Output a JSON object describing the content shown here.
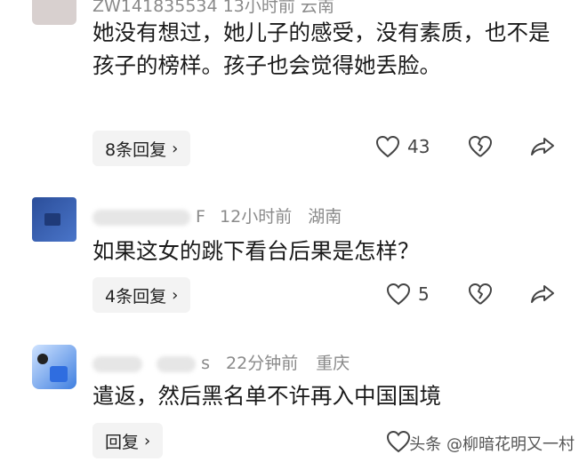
{
  "comments": [
    {
      "username": "ZW141835534 13小时前 云南",
      "text": "她没有想过，她儿子的感受，没有素质，也不是孩子的榜样。孩子也会觉得她丢脸。",
      "reply_label": "8条回复",
      "like_count": "43"
    },
    {
      "username": "F",
      "time": "12小时前",
      "location": "湖南",
      "text": "如果这女的跳下看台后果是怎样？",
      "reply_label": "4条回复",
      "like_count": "5"
    },
    {
      "username": "s",
      "time": "22分钟前",
      "location": "重庆",
      "text": "遣返，然后黑名单不许再入中国国境",
      "reply_label": "回复"
    }
  ],
  "watermark": "头条 @柳暗花明又一村",
  "colors": {
    "meta": "#8a8a8a",
    "reply_bg": "#f3f3f3",
    "text": "#1a1a1a"
  },
  "icons": [
    "like-heart-icon",
    "dislike-broken-heart-icon",
    "share-arrow-icon",
    "chevron-right-icon"
  ]
}
